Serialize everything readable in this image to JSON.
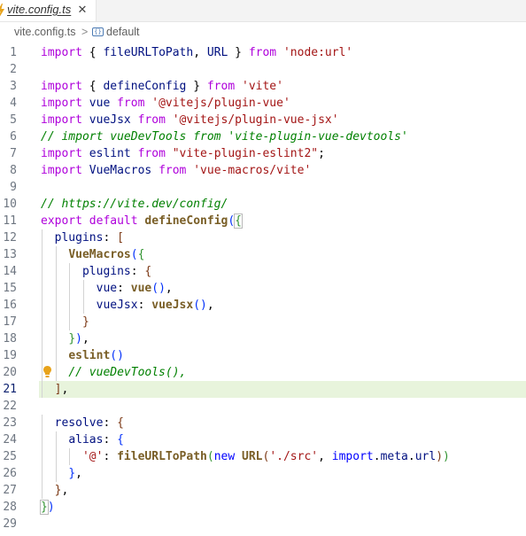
{
  "tab": {
    "label": "vite.config.ts",
    "close_glyph": "✕",
    "icon": "lightning-icon"
  },
  "breadcrumb": {
    "file": "vite.config.ts",
    "separator": ">",
    "symbol": "default",
    "symbol_icon": "symbol-icon"
  },
  "editor": {
    "current_line": 21,
    "lines": [
      {
        "n": "1",
        "tokens": [
          [
            "ex",
            "import"
          ],
          [
            "pn",
            " { "
          ],
          [
            "prop",
            "fileURLToPath"
          ],
          [
            "pn",
            ", "
          ],
          [
            "prop",
            "URL"
          ],
          [
            "pn",
            " } "
          ],
          [
            "ex",
            "from"
          ],
          [
            "pn",
            " "
          ],
          [
            "str",
            "'node:url'"
          ]
        ]
      },
      {
        "n": "2",
        "tokens": []
      },
      {
        "n": "3",
        "tokens": [
          [
            "ex",
            "import"
          ],
          [
            "pn",
            " { "
          ],
          [
            "prop",
            "defineConfig"
          ],
          [
            "pn",
            " } "
          ],
          [
            "ex",
            "from"
          ],
          [
            "pn",
            " "
          ],
          [
            "str",
            "'vite'"
          ]
        ]
      },
      {
        "n": "4",
        "tokens": [
          [
            "ex",
            "import"
          ],
          [
            "pn",
            " "
          ],
          [
            "prop",
            "vue"
          ],
          [
            "pn",
            " "
          ],
          [
            "ex",
            "from"
          ],
          [
            "pn",
            " "
          ],
          [
            "str",
            "'@vitejs/plugin-vue'"
          ]
        ]
      },
      {
        "n": "5",
        "tokens": [
          [
            "ex",
            "import"
          ],
          [
            "pn",
            " "
          ],
          [
            "prop",
            "vueJsx"
          ],
          [
            "pn",
            " "
          ],
          [
            "ex",
            "from"
          ],
          [
            "pn",
            " "
          ],
          [
            "str",
            "'@vitejs/plugin-vue-jsx'"
          ]
        ]
      },
      {
        "n": "6",
        "tokens": [
          [
            "cm",
            "// import vueDevTools from 'vite-plugin-vue-devtools'"
          ]
        ]
      },
      {
        "n": "7",
        "tokens": [
          [
            "ex",
            "import"
          ],
          [
            "pn",
            " "
          ],
          [
            "prop",
            "eslint"
          ],
          [
            "pn",
            " "
          ],
          [
            "ex",
            "from"
          ],
          [
            "pn",
            " "
          ],
          [
            "str",
            "\"vite-plugin-eslint2\""
          ],
          [
            "pn",
            ";"
          ]
        ]
      },
      {
        "n": "8",
        "tokens": [
          [
            "ex",
            "import"
          ],
          [
            "pn",
            " "
          ],
          [
            "prop",
            "VueMacros"
          ],
          [
            "pn",
            " "
          ],
          [
            "ex",
            "from"
          ],
          [
            "pn",
            " "
          ],
          [
            "str",
            "'vue-macros/vite'"
          ]
        ]
      },
      {
        "n": "9",
        "tokens": []
      },
      {
        "n": "10",
        "tokens": [
          [
            "cm",
            "// https://vite.dev/config/"
          ]
        ]
      },
      {
        "n": "11",
        "tokens": [
          [
            "ex",
            "export"
          ],
          [
            "pn",
            " "
          ],
          [
            "ex",
            "default"
          ],
          [
            "pn",
            " "
          ],
          [
            "bf",
            "defineConfig"
          ],
          [
            "br1",
            "("
          ],
          [
            "br2hl",
            "{"
          ]
        ]
      },
      {
        "n": "12",
        "tokens": [
          [
            "pn",
            "  "
          ],
          [
            "prop",
            "plugins"
          ],
          [
            "pn",
            ": "
          ],
          [
            "br3",
            "["
          ]
        ]
      },
      {
        "n": "13",
        "tokens": [
          [
            "pn",
            "    "
          ],
          [
            "bf",
            "VueMacros"
          ],
          [
            "br1",
            "("
          ],
          [
            "br2",
            "{"
          ]
        ]
      },
      {
        "n": "14",
        "tokens": [
          [
            "pn",
            "      "
          ],
          [
            "prop",
            "plugins"
          ],
          [
            "pn",
            ": "
          ],
          [
            "br3",
            "{"
          ]
        ]
      },
      {
        "n": "15",
        "tokens": [
          [
            "pn",
            "        "
          ],
          [
            "prop",
            "vue"
          ],
          [
            "pn",
            ": "
          ],
          [
            "bf",
            "vue"
          ],
          [
            "br1",
            "()"
          ],
          [
            "pn",
            ","
          ]
        ]
      },
      {
        "n": "16",
        "tokens": [
          [
            "pn",
            "        "
          ],
          [
            "prop",
            "vueJsx"
          ],
          [
            "pn",
            ": "
          ],
          [
            "bf",
            "vueJsx"
          ],
          [
            "br1",
            "()"
          ],
          [
            "pn",
            ","
          ]
        ]
      },
      {
        "n": "17",
        "tokens": [
          [
            "pn",
            "      "
          ],
          [
            "br3",
            "}"
          ]
        ]
      },
      {
        "n": "18",
        "tokens": [
          [
            "pn",
            "    "
          ],
          [
            "br2",
            "}"
          ],
          [
            "br1",
            ")"
          ],
          [
            "pn",
            ","
          ]
        ]
      },
      {
        "n": "19",
        "tokens": [
          [
            "pn",
            "    "
          ],
          [
            "bf",
            "eslint"
          ],
          [
            "br1",
            "()"
          ]
        ]
      },
      {
        "n": "20",
        "tokens": [
          [
            "pn",
            "    "
          ],
          [
            "cm",
            "// vueDevTools(),"
          ]
        ]
      },
      {
        "n": "21",
        "tokens": [
          [
            "pn",
            "  "
          ],
          [
            "br3",
            "]"
          ],
          [
            "pn",
            ","
          ]
        ]
      },
      {
        "n": "22",
        "tokens": []
      },
      {
        "n": "23",
        "tokens": [
          [
            "pn",
            "  "
          ],
          [
            "prop",
            "resolve"
          ],
          [
            "pn",
            ": "
          ],
          [
            "br3",
            "{"
          ]
        ]
      },
      {
        "n": "24",
        "tokens": [
          [
            "pn",
            "    "
          ],
          [
            "prop",
            "alias"
          ],
          [
            "pn",
            ": "
          ],
          [
            "br1",
            "{"
          ]
        ]
      },
      {
        "n": "25",
        "tokens": [
          [
            "pn",
            "      "
          ],
          [
            "str",
            "'@'"
          ],
          [
            "pn",
            ": "
          ],
          [
            "bf",
            "fileURLToPath"
          ],
          [
            "br2",
            "("
          ],
          [
            "kw",
            "new"
          ],
          [
            "pn",
            " "
          ],
          [
            "bf",
            "URL"
          ],
          [
            "br3",
            "("
          ],
          [
            "str",
            "'./src'"
          ],
          [
            "pn",
            ", "
          ],
          [
            "kw",
            "import"
          ],
          [
            "pn",
            "."
          ],
          [
            "prop",
            "meta"
          ],
          [
            "pn",
            "."
          ],
          [
            "prop",
            "url"
          ],
          [
            "br3",
            ")"
          ],
          [
            "br2",
            ")"
          ]
        ]
      },
      {
        "n": "26",
        "tokens": [
          [
            "pn",
            "    "
          ],
          [
            "br1",
            "}"
          ],
          [
            "pn",
            ","
          ]
        ]
      },
      {
        "n": "27",
        "tokens": [
          [
            "pn",
            "  "
          ],
          [
            "br3",
            "}"
          ],
          [
            "pn",
            ","
          ]
        ]
      },
      {
        "n": "28",
        "tokens": [
          [
            "br2hl",
            "}"
          ],
          [
            "br1",
            ")"
          ]
        ]
      },
      {
        "n": "29",
        "tokens": []
      }
    ]
  },
  "colors": {
    "keyword_control": "#af00db",
    "string": "#a31515",
    "comment": "#008000",
    "function": "#795e26",
    "current_line_bg": "#e8f4dc",
    "bulb": "#e8a31b",
    "tab_icon": "#e8a31b"
  }
}
